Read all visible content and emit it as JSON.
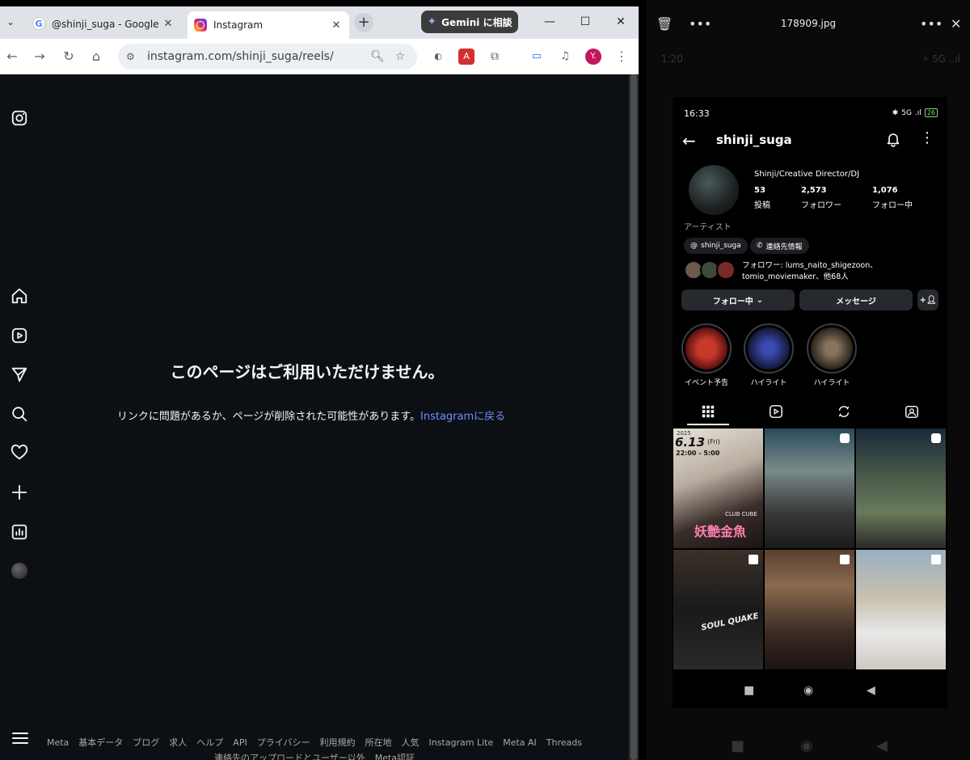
{
  "browser": {
    "tabs": [
      {
        "title": "@shinji_suga - Google 検",
        "active": false
      },
      {
        "title": "Instagram",
        "active": true
      }
    ],
    "gemini_label": "Gemini に相談",
    "url": "instagram.com/shinji_suga/reels/",
    "profile_initial": "Y."
  },
  "instagram_page": {
    "error_title": "このページはご利用いただけません。",
    "error_message": "リンクに問題があるか、ページが削除された可能性があります。",
    "back_link": "Instagramに戻る",
    "footer_row1": [
      "Meta",
      "基本データ",
      "ブログ",
      "求人",
      "ヘルプ",
      "API",
      "プライバシー",
      "利用規約",
      "所在地",
      "人気",
      "Instagram Lite",
      "Meta AI",
      "Threads"
    ],
    "footer_row2": [
      "連絡先のアップロードとユーザー以外",
      "Meta認証"
    ]
  },
  "viewer": {
    "filename": "178909.jpg",
    "ghost_time": "1:20"
  },
  "phone": {
    "time": "16:33",
    "status_right": "5G",
    "battery": "26",
    "username": "shinji_suga",
    "bio": "Shinji/Creative Director/DJ",
    "stats": [
      {
        "value": "53",
        "label": "投稿"
      },
      {
        "value": "2,573",
        "label": "フォロワー"
      },
      {
        "value": "1,076",
        "label": "フォロー中"
      }
    ],
    "category": "アーティスト",
    "chips": [
      "shinji_suga",
      "連絡先情報"
    ],
    "followers_line1": "フォロワー: lums_naito_shigezoon、",
    "followers_line2": "tomio_moviemaker、他68人",
    "follow_button": "フォロー中",
    "message_button": "メッセージ",
    "highlights": [
      "イベント予告",
      "ハイライト",
      "ハイライト"
    ],
    "post_overlay": {
      "date": "6.13",
      "day": "(Fri)",
      "time": "22:00 - 5:00",
      "title": "妖艶金魚",
      "venue": "CLUB CUBE",
      "year": "2025",
      "badge": "SOUL QUAKE"
    }
  }
}
